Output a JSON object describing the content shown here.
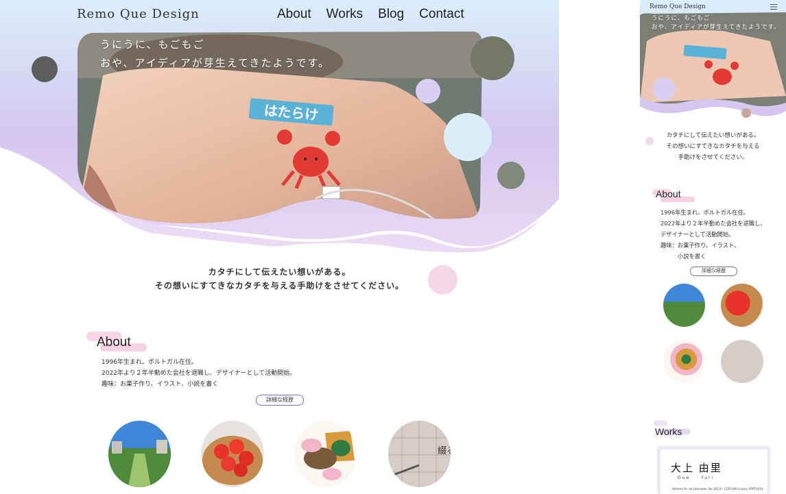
{
  "site": {
    "logo": "Remo Que Design",
    "nav": [
      "About",
      "Works",
      "Blog",
      "Contact"
    ]
  },
  "hero": {
    "line1": "うにうに、もごもご",
    "line2": "おや、アイディアが芽生えてきたようです。",
    "sticker_text": "はたらけ"
  },
  "tagline": {
    "line1": "カタチにして伝えたい想いがある。",
    "line2": "その想いにすてきなカタチを与える手助けをさせてください。"
  },
  "about": {
    "heading": "About",
    "lines": [
      "1996年生まれ。ポルトガル在住。",
      "2022年より２年半勤めた会社を退職し、デザイナーとして活動開始。",
      "趣味：お菓子作り、イラスト、小説を書く"
    ],
    "button": "詳細な経歴",
    "images": [
      "park-photo",
      "strawberry-tart-photo",
      "duck-illustration",
      "pen-manuscript-photo"
    ],
    "manuscript_text": "綴る"
  },
  "mobile": {
    "logo": "Remo Que Design",
    "hero_line1": "うにうに、もごもご",
    "hero_line2": "おや、アイディアが芽生えてきたようです。",
    "tagline": [
      "カタチにして伝えたい想いがある。",
      "その想いにすてきなカタチを与える",
      "手助けをさせてください。"
    ],
    "about_heading": "About",
    "about_lines": [
      "1996年生まれ。ポルトガル在住。",
      "2022年より２年半勤めた会社を退職し、",
      "デザイナーとして活動開始。",
      "趣味：お菓子作り、イラスト、",
      "　　　小説を書く"
    ],
    "about_button": "詳細な経歴",
    "works_heading": "Works",
    "card_name": "大上 由里",
    "card_romaji": "Oue　　Yuri",
    "card_address": "Address  Av. da Liberdade, No.245 6º, 1250-000 Lisboa, PORTUGAL"
  },
  "colors": {
    "lavender": "#cdb8ea",
    "sky": "#dceefa",
    "pink": "#f7d4e6",
    "button_border": "#6f73b3"
  }
}
